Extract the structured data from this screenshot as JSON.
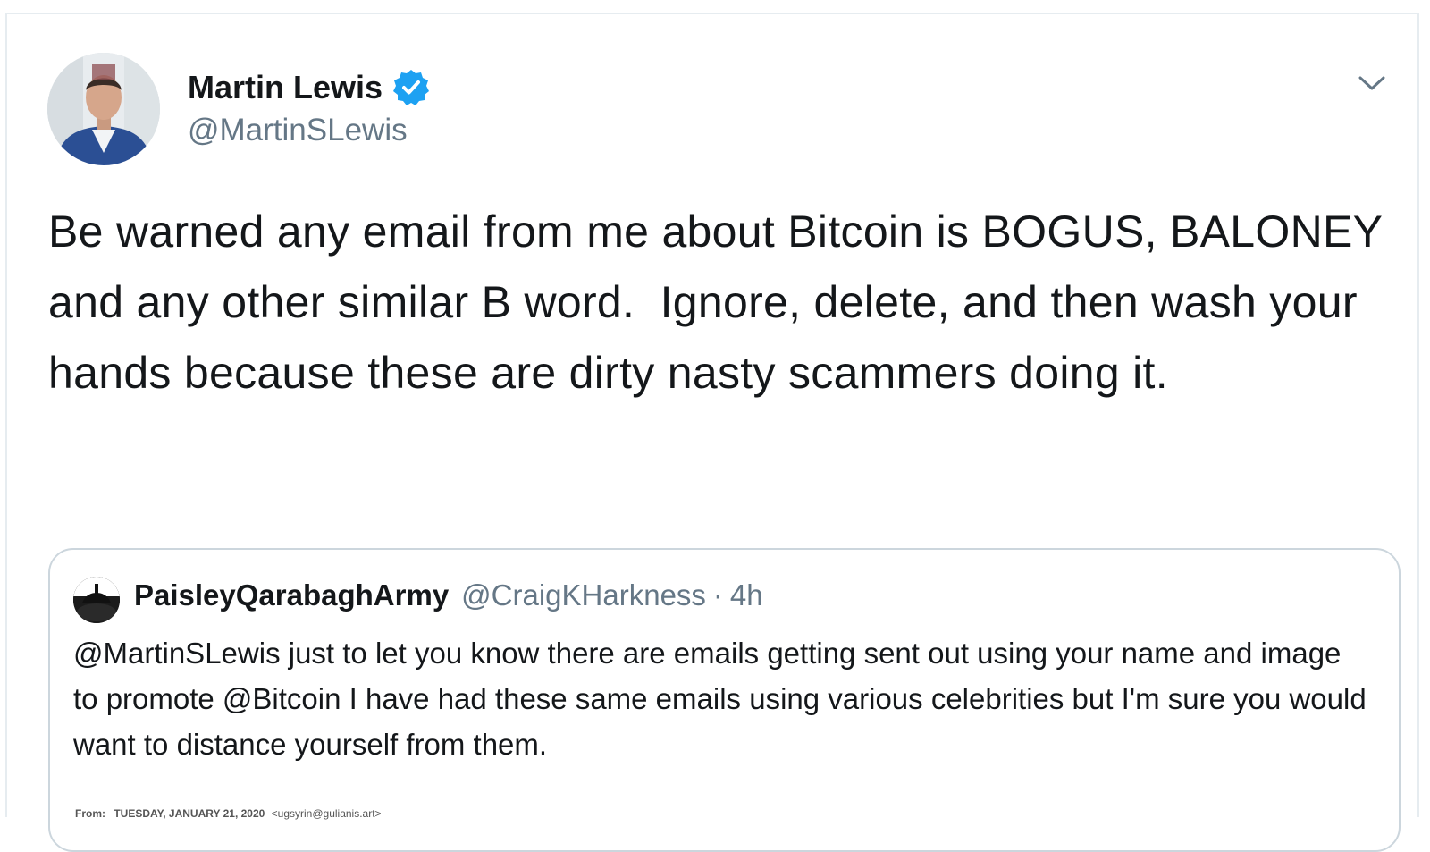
{
  "tweet": {
    "author_name": "Martin Lewis",
    "author_handle": "@MartinSLewis",
    "verified": true,
    "text": "Be warned any email from me about Bitcoin is BOGUS, BALONEY and any other similar B word.  Ignore, delete, and then wash your hands because these are dirty nasty scammers doing it.",
    "icons": {
      "verified": "verified-badge-icon",
      "menu": "chevron-down-icon"
    },
    "accent_color": "#1da1f2"
  },
  "quoted_tweet": {
    "author_name": "PaisleyQarabaghArmy",
    "author_handle": "@CraigKHarkness",
    "separator": "·",
    "time": "4h",
    "text": "@MartinSLewis just to let you know there are emails getting sent out using your name and image to promote @Bitcoin  I have had these same emails using various celebrities but I'm sure you would want to distance yourself from them.",
    "email_preview": {
      "from_label": "From:",
      "date": "TUESDAY, JANUARY 21, 2020",
      "address": "<ugsyrin@gulianis.art>"
    }
  }
}
